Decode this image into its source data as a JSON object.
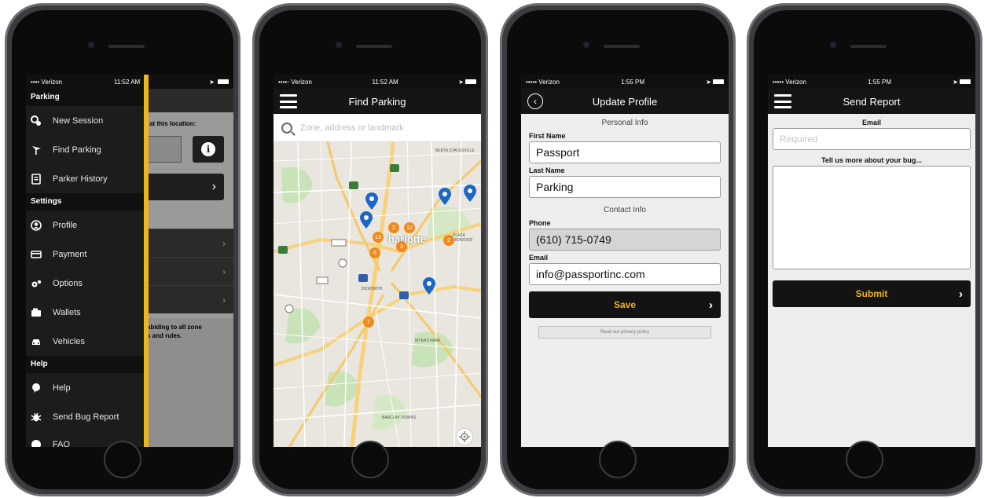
{
  "status_bars": [
    {
      "carrier": "•••• Verizon",
      "time": "11:52 AM"
    },
    {
      "carrier": "••••◦ Verizon",
      "time": "11:52 AM"
    },
    {
      "carrier": "••••• Verizon",
      "time": "1:55 PM"
    },
    {
      "carrier": "••••• Verizon",
      "time": "1:55 PM"
    }
  ],
  "menu": {
    "sections": [
      {
        "title": "Parking",
        "items": [
          {
            "label": "New Session",
            "icon": "parking-session-icon"
          },
          {
            "label": "Find Parking",
            "icon": "flag-icon"
          },
          {
            "label": "Parker History",
            "icon": "receipt-icon"
          }
        ]
      },
      {
        "title": "Settings",
        "items": [
          {
            "label": "Profile",
            "icon": "user-icon"
          },
          {
            "label": "Payment",
            "icon": "credit-card-icon"
          },
          {
            "label": "Options",
            "icon": "gears-icon"
          },
          {
            "label": "Wallets",
            "icon": "wallet-icon"
          },
          {
            "label": "Vehicles",
            "icon": "car-icon"
          }
        ]
      },
      {
        "title": "Help",
        "items": [
          {
            "label": "Help",
            "icon": "help-bubble-icon"
          },
          {
            "label": "Send Bug Report",
            "icon": "bug-icon"
          },
          {
            "label": "FAQ",
            "icon": "faq-icon"
          }
        ]
      }
    ],
    "background": {
      "location_text": "d at this location:",
      "info_glyph": "i",
      "chevron": "›",
      "note_text": "abiding to all zone\ns and rules."
    }
  },
  "find_parking": {
    "title": "Find Parking",
    "search_placeholder": "Zone, address or landmark",
    "map_city_label": "harlotte",
    "map_labels": [
      "DILWORTH",
      "MYERS PARK",
      "BARCLAY DOWNS",
      "PLAZA MIDWOOD",
      "BERTA STATESVILLE"
    ],
    "pin_color": "#1a66c9",
    "cluster_color": "#f08a1c",
    "clusters": [
      "2",
      "13",
      "3",
      "12",
      "8",
      "2",
      "7"
    ]
  },
  "update_profile": {
    "title": "Update Profile",
    "personal_info": "Personal Info",
    "first_name_label": "First Name",
    "first_name": "Passport",
    "last_name_label": "Last Name",
    "last_name": "Parking",
    "contact_info": "Contact Info",
    "phone_label": "Phone",
    "phone": "(610) 715-0749",
    "email_label": "Email",
    "email": "info@passportinc.com",
    "save_label": "Save",
    "privacy_label": "Read our privacy policy"
  },
  "send_report": {
    "title": "Send Report",
    "email_label": "Email",
    "email_placeholder": "Required",
    "bug_label": "Tell us more about your bug...",
    "submit_label": "Submit"
  },
  "colors": {
    "accent": "#f0b41c",
    "dark": "#131313",
    "background": "#ededed"
  }
}
